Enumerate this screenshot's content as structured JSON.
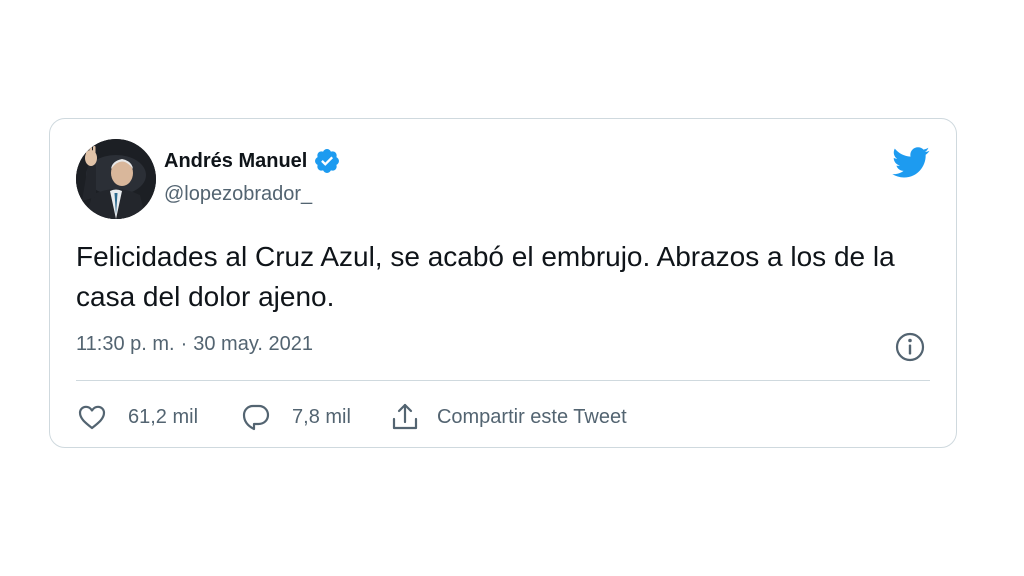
{
  "tweet": {
    "author": {
      "display_name": "Andrés Manuel",
      "handle": "@lopezobrador_",
      "verified": true
    },
    "text": "Felicidades al Cruz Azul, se acabó el embrujo. Abrazos a los de la casa del dolor ajeno.",
    "time": "11:30 p. m.",
    "separator": "·",
    "date": "30 may. 2021",
    "actions": {
      "likes": "61,2 mil",
      "replies": "7,8 mil",
      "share": "Compartir este Tweet"
    }
  },
  "icons": {
    "brand": "twitter-bird-icon",
    "verified": "verified-badge-icon",
    "info": "info-icon",
    "like": "heart-icon",
    "reply": "speech-bubble-icon",
    "share": "share-upload-icon"
  },
  "colors": {
    "brand": "#1d9bf0",
    "text": "#0f1419",
    "secondary": "#536471",
    "border": "#cfd9de"
  }
}
